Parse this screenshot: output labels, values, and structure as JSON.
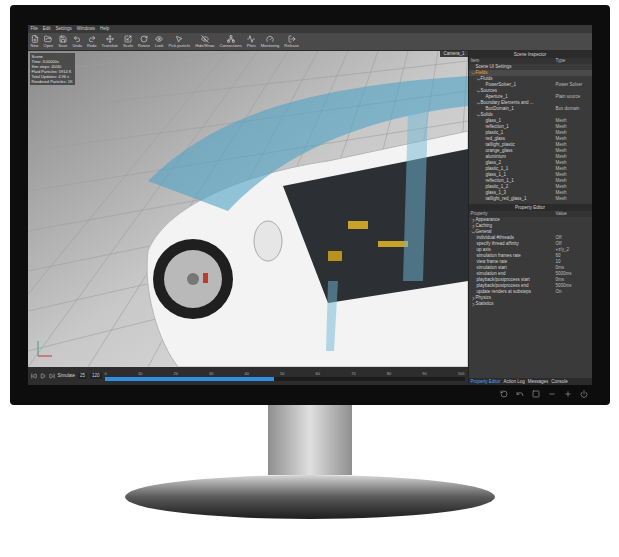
{
  "menu": [
    "File",
    "Edit",
    "Settings",
    "Windows",
    "Help"
  ],
  "toolbar": [
    {
      "label": "New"
    },
    {
      "label": "Open"
    },
    {
      "label": "Save"
    },
    {
      "label": "Undo"
    },
    {
      "label": "Redo"
    },
    {
      "label": "Translate"
    },
    {
      "label": "Scale"
    },
    {
      "label": "Rotate"
    },
    {
      "label": "Look"
    },
    {
      "label": "Pick particle"
    },
    {
      "label": "Hide/Show"
    },
    {
      "label": "Connections"
    },
    {
      "label": "Plots"
    },
    {
      "label": "Monitoring"
    },
    {
      "label": "Release"
    }
  ],
  "viewport": {
    "camera_tab": "Camera_1",
    "overlay": [
      "Scene",
      "Time: 3.00000s",
      "Sim steps: 40/40",
      "Fluid Particles: 5914 K",
      "Total Updates: 4.96 s",
      "Rendered Particles: 1K"
    ]
  },
  "timeline": {
    "mode": "Simulate",
    "start": "25",
    "end": "120",
    "ticks": [
      "0",
      "10",
      "20",
      "30",
      "40",
      "50",
      "60",
      "70",
      "80",
      "90",
      "100"
    ],
    "level": 0.47
  },
  "inspector": {
    "title": "Scene Inspector",
    "columns": [
      "Item",
      "Type"
    ],
    "items": [
      {
        "label": "Scene UI Settings",
        "type": "",
        "expanded": false,
        "selected": false,
        "children": []
      },
      {
        "label": "Fields",
        "type": "",
        "expanded": true,
        "selected": true,
        "children": [
          {
            "label": "Fluids",
            "type": "",
            "expanded": true,
            "selected": false,
            "children": [
              {
                "label": "PowerSolver_1",
                "type": "Power Solver",
                "expanded": false,
                "selected": false,
                "children": []
              }
            ]
          },
          {
            "label": "Sources",
            "type": "",
            "expanded": true,
            "selected": false,
            "children": [
              {
                "label": "Aperture_1",
                "type": "Plain source",
                "expanded": false,
                "selected": false,
                "children": []
              }
            ]
          },
          {
            "label": "Boundary Elements and ...",
            "type": "",
            "expanded": true,
            "selected": false,
            "children": [
              {
                "label": "BoxDomain_1",
                "type": "Box domain",
                "expanded": false,
                "selected": false,
                "children": []
              }
            ]
          },
          {
            "label": "Solids",
            "type": "",
            "expanded": true,
            "selected": false,
            "children": [
              {
                "label": "glass_1",
                "type": "Mesh",
                "expanded": false,
                "selected": false,
                "children": []
              },
              {
                "label": "reflection_1",
                "type": "Mesh",
                "expanded": false,
                "selected": false,
                "children": []
              },
              {
                "label": "plastic_1",
                "type": "Mesh",
                "expanded": false,
                "selected": false,
                "children": []
              },
              {
                "label": "red_glass",
                "type": "Mesh",
                "expanded": false,
                "selected": false,
                "children": []
              },
              {
                "label": "taillight_plastic",
                "type": "Mesh",
                "expanded": false,
                "selected": false,
                "children": []
              },
              {
                "label": "orange_glass",
                "type": "Mesh",
                "expanded": false,
                "selected": false,
                "children": []
              },
              {
                "label": "aluminium",
                "type": "Mesh",
                "expanded": false,
                "selected": false,
                "children": []
              },
              {
                "label": "glass_2",
                "type": "Mesh",
                "expanded": false,
                "selected": false,
                "children": []
              },
              {
                "label": "plastic_1_1",
                "type": "Mesh",
                "expanded": false,
                "selected": false,
                "children": []
              },
              {
                "label": "glass_1_1",
                "type": "Mesh",
                "expanded": false,
                "selected": false,
                "children": []
              },
              {
                "label": "reflection_1_1",
                "type": "Mesh",
                "expanded": false,
                "selected": false,
                "children": []
              },
              {
                "label": "plastic_1_2",
                "type": "Mesh",
                "expanded": false,
                "selected": false,
                "children": []
              },
              {
                "label": "glass_1_3",
                "type": "Mesh",
                "expanded": false,
                "selected": false,
                "children": []
              },
              {
                "label": "taillight_red_glass_1",
                "type": "Mesh",
                "expanded": false,
                "selected": false,
                "children": []
              }
            ]
          }
        ]
      }
    ]
  },
  "property_editor": {
    "columns": [
      "Property",
      "Value"
    ],
    "groups": [
      {
        "label": "Appearance",
        "expanded": false,
        "rows": []
      },
      {
        "label": "Caching",
        "expanded": false,
        "rows": []
      },
      {
        "label": "General",
        "expanded": true,
        "rows": [
          {
            "name": "individual #threads",
            "value": "Off"
          },
          {
            "name": "specify thread affinity",
            "value": "Off"
          },
          {
            "name": "up axis",
            "value": "+z/y_2"
          },
          {
            "name": "simulation frames rate",
            "value": "60"
          },
          {
            "name": "view frame rate",
            "value": "10"
          },
          {
            "name": "simulation start",
            "value": "0ms"
          },
          {
            "name": "simulation end",
            "value": "5000ms"
          },
          {
            "name": "playback/postprocess start",
            "value": "0ms"
          },
          {
            "name": "playback/postprocess end",
            "value": "5000ms"
          },
          {
            "name": "update renders at substeps",
            "value": "On"
          }
        ]
      },
      {
        "label": "Physics",
        "expanded": false,
        "rows": []
      },
      {
        "label": "Statistics",
        "expanded": false,
        "rows": []
      }
    ]
  },
  "bottom_tabs": [
    {
      "label": "Property Editor",
      "selected": true
    },
    {
      "label": "Action Log",
      "selected": false
    },
    {
      "label": "Messages",
      "selected": false
    },
    {
      "label": "Console",
      "selected": false
    }
  ]
}
